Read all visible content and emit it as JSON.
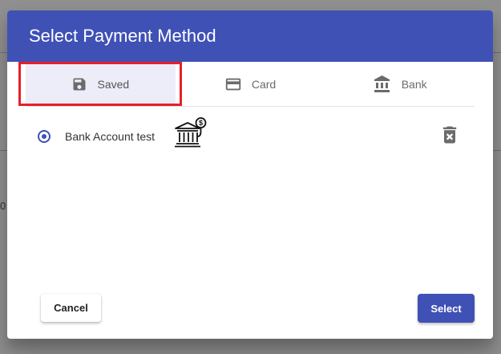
{
  "dialog": {
    "title": "Select Payment Method"
  },
  "tabs": [
    {
      "label": "Saved",
      "icon": "save-icon",
      "active": true
    },
    {
      "label": "Card",
      "icon": "credit-card-icon",
      "active": false
    },
    {
      "label": "Bank",
      "icon": "bank-icon",
      "active": false
    }
  ],
  "saved_methods": [
    {
      "label": "Bank Account test",
      "selected": true,
      "icon": "bank-dollar-icon"
    }
  ],
  "actions": {
    "cancel_label": "Cancel",
    "select_label": "Select"
  },
  "background": {
    "partial_text": "0"
  },
  "colors": {
    "primary": "#3f51b5",
    "highlight": "#e5202a",
    "active_tab_bg": "#ecedf8",
    "icon_gray": "#6b6b6b"
  }
}
